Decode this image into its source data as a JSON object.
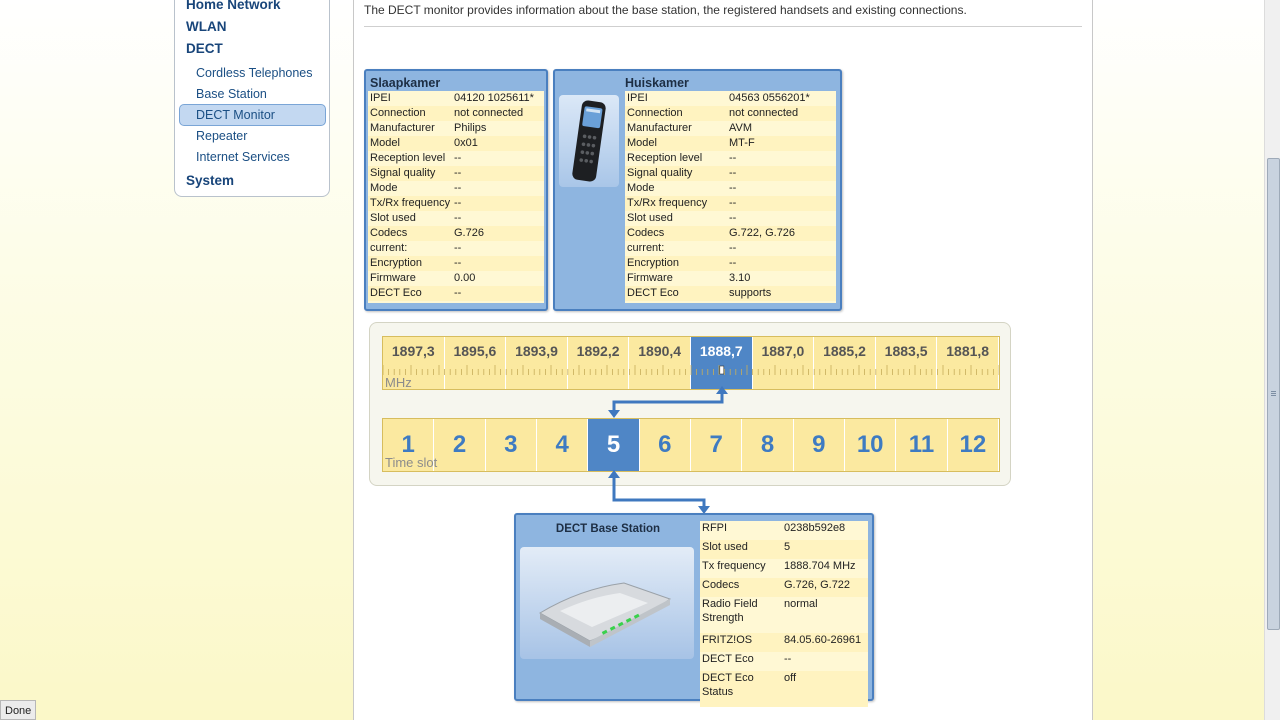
{
  "nav": {
    "main": [
      "Home Network",
      "WLAN",
      "DECT",
      "System"
    ],
    "sub": [
      "Cordless Telephones",
      "Base Station",
      "DECT Monitor",
      "Repeater",
      "Internet Services"
    ],
    "active": "DECT Monitor"
  },
  "page": {
    "description": "The DECT monitor provides information about the base station, the registered handsets and existing connections."
  },
  "handsets": [
    {
      "title": "Slaapkamer",
      "rows": [
        [
          "IPEI",
          "04120 1025611*"
        ],
        [
          "Connection",
          "not connected"
        ],
        [
          "Manufacturer",
          "Philips"
        ],
        [
          "Model",
          "0x01"
        ],
        [
          "Reception level",
          "--"
        ],
        [
          "Signal quality",
          "--"
        ],
        [
          "Mode",
          "--"
        ],
        [
          "Tx/Rx frequency",
          "--"
        ],
        [
          "Slot used",
          "--"
        ],
        [
          "Codecs",
          "G.726"
        ],
        [
          "current:",
          "--"
        ],
        [
          "Encryption",
          "--"
        ],
        [
          "Firmware",
          "0.00"
        ],
        [
          "DECT Eco",
          "--"
        ]
      ]
    },
    {
      "title": "Huiskamer",
      "rows": [
        [
          "IPEI",
          "04563 0556201*"
        ],
        [
          "Connection",
          "not connected"
        ],
        [
          "Manufacturer",
          "AVM"
        ],
        [
          "Model",
          "MT-F"
        ],
        [
          "Reception level",
          "--"
        ],
        [
          "Signal quality",
          "--"
        ],
        [
          "Mode",
          "--"
        ],
        [
          "Tx/Rx frequency",
          "--"
        ],
        [
          "Slot used",
          "--"
        ],
        [
          "Codecs",
          "G.722, G.726"
        ],
        [
          "current:",
          "--"
        ],
        [
          "Encryption",
          "--"
        ],
        [
          "Firmware",
          "3.10"
        ],
        [
          "DECT Eco",
          "supports"
        ]
      ]
    }
  ],
  "frequency": {
    "values": [
      "1897,3",
      "1895,6",
      "1893,9",
      "1892,2",
      "1890,4",
      "1888,7",
      "1887,0",
      "1885,2",
      "1883,5",
      "1881,8"
    ],
    "active_index": 5,
    "unit": "MHz"
  },
  "timeslots": {
    "values": [
      "1",
      "2",
      "3",
      "4",
      "5",
      "6",
      "7",
      "8",
      "9",
      "10",
      "11",
      "12"
    ],
    "active_index": 4,
    "label": "Time slot"
  },
  "base_station": {
    "title": "DECT Base Station",
    "rows": [
      [
        "RFPI",
        "0238b592e8"
      ],
      [
        "Slot used",
        "5"
      ],
      [
        "Tx frequency",
        "1888.704 MHz"
      ],
      [
        "Codecs",
        "G.726, G.722"
      ],
      [
        "Radio Field Strength",
        "normal"
      ],
      [
        "FRITZ!OS",
        "84.05.60-26961"
      ],
      [
        "DECT Eco",
        "--"
      ],
      [
        "DECT Eco Status",
        "off"
      ]
    ]
  },
  "status": {
    "text": "Done"
  },
  "colors": {
    "accent": "#4f86c6",
    "panel": "#8eb5e0",
    "row": "#fff8d4",
    "nav": "#18457a"
  }
}
